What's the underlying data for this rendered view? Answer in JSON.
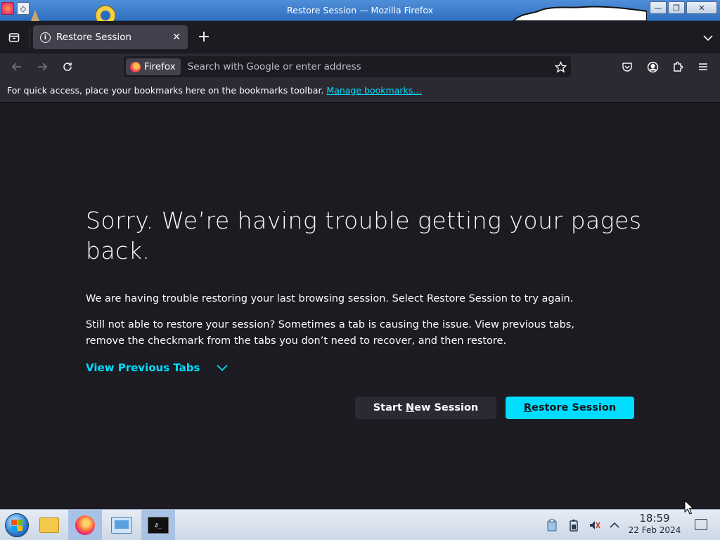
{
  "window": {
    "title": "Restore Session — Mozilla Firefox",
    "controls": {
      "minimize": "—",
      "maximize": "❐",
      "close": "✕"
    }
  },
  "tabs": [
    {
      "label": "Restore Session",
      "icon": "info-icon",
      "close": "✕"
    }
  ],
  "urlbar": {
    "identity_label": "Firefox",
    "placeholder": "Search with Google or enter address"
  },
  "bookmarks_bar": {
    "text": "For quick access, place your bookmarks here on the bookmarks toolbar.",
    "link": "Manage bookmarks…"
  },
  "page": {
    "heading": "Sorry. We’re having trouble getting your pages back.",
    "para1": "We are having trouble restoring your last browsing session. Select Restore Session to try again.",
    "para2": "Still not able to restore your session? Sometimes a tab is causing the issue. View previous tabs, remove the checkmark from the tabs you don’t need to recover, and then restore.",
    "view_previous_tabs": "View Previous Tabs",
    "start_new_session": {
      "before": "Start ",
      "accesskey": "N",
      "after": "ew Session"
    },
    "restore_session": {
      "before": "",
      "accesskey": "R",
      "after": "estore Session"
    }
  },
  "taskbar": {
    "time": "18:59",
    "date": "22 Feb 2024",
    "items": [
      "start-menu",
      "file-manager",
      "firefox",
      "system-settings",
      "terminal"
    ],
    "tray": [
      "clipboard-icon",
      "battery-icon",
      "volume-muted-icon",
      "chevron-up-icon"
    ]
  },
  "colors": {
    "accent": "#00ddff",
    "content_bg": "#1c1b22",
    "toolbar_bg": "#2b2a33",
    "titlebar": "#2f6fc0"
  }
}
